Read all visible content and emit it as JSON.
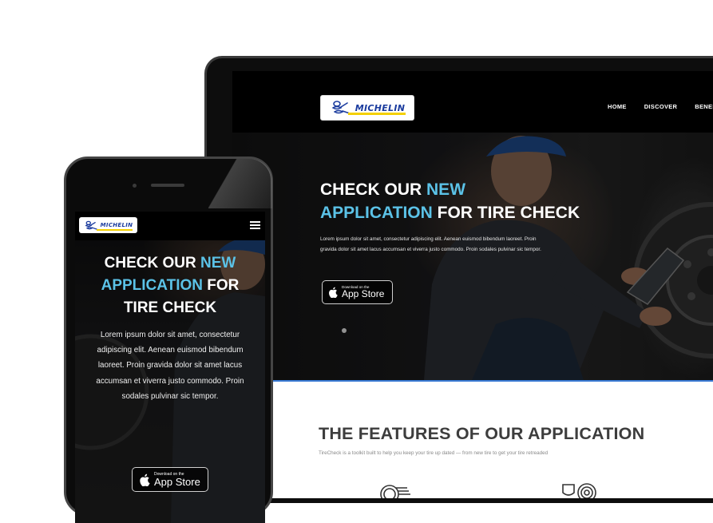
{
  "brand": {
    "name": "MICHELIN"
  },
  "desktop": {
    "nav": {
      "items": [
        "HOME",
        "DISCOVER",
        "BENEFITS"
      ]
    },
    "hero": {
      "title_part1": "CHECK OUR ",
      "title_accent": "NEW",
      "title_line2_accent": "APPLICATION",
      "title_line2_rest": " FOR TIRE CHECK",
      "description": "Lorem ipsum dolor sit amet, consectetur adipiscing elit. Aenean euismod bibendum laoreet. Proin gravida dolor sit amet lacus accumsan et viverra justo commodo. Proin sodales pulvinar sic tempor.",
      "app_store_small": "Download on the",
      "app_store_big": "App Store"
    },
    "features": {
      "title": "THE FEATURES OF OUR APPLICATION",
      "subtitle": "TireCheck is a toolkit built to help you keep your tire up dated — from new tire to get your tire retreaded"
    }
  },
  "mobile": {
    "hero": {
      "title_line1_part1": "CHECK OUR ",
      "title_line1_accent": "NEW",
      "title_line2_accent": "APPLICATION",
      "title_line2_rest": " FOR",
      "title_line3": "TIRE CHECK",
      "description": "Lorem ipsum dolor sit amet, consectetur adipiscing elit. Aenean euismod bibendum laoreet. Proin gravida dolor sit amet lacus accumsan et viverra justo commodo. Proin sodales pulvinar sic tempor.",
      "app_store_small": "Download on the",
      "app_store_big": "App Store"
    }
  },
  "colors": {
    "accent": "#5bc2e7",
    "brand_blue": "#1a3b9e",
    "brand_yellow": "#f4d000",
    "hero_border": "#3a7bd5"
  },
  "icons": [
    "apple-icon",
    "hamburger-menu-icon",
    "tire-tread-icon",
    "tire-gauge-icon"
  ]
}
